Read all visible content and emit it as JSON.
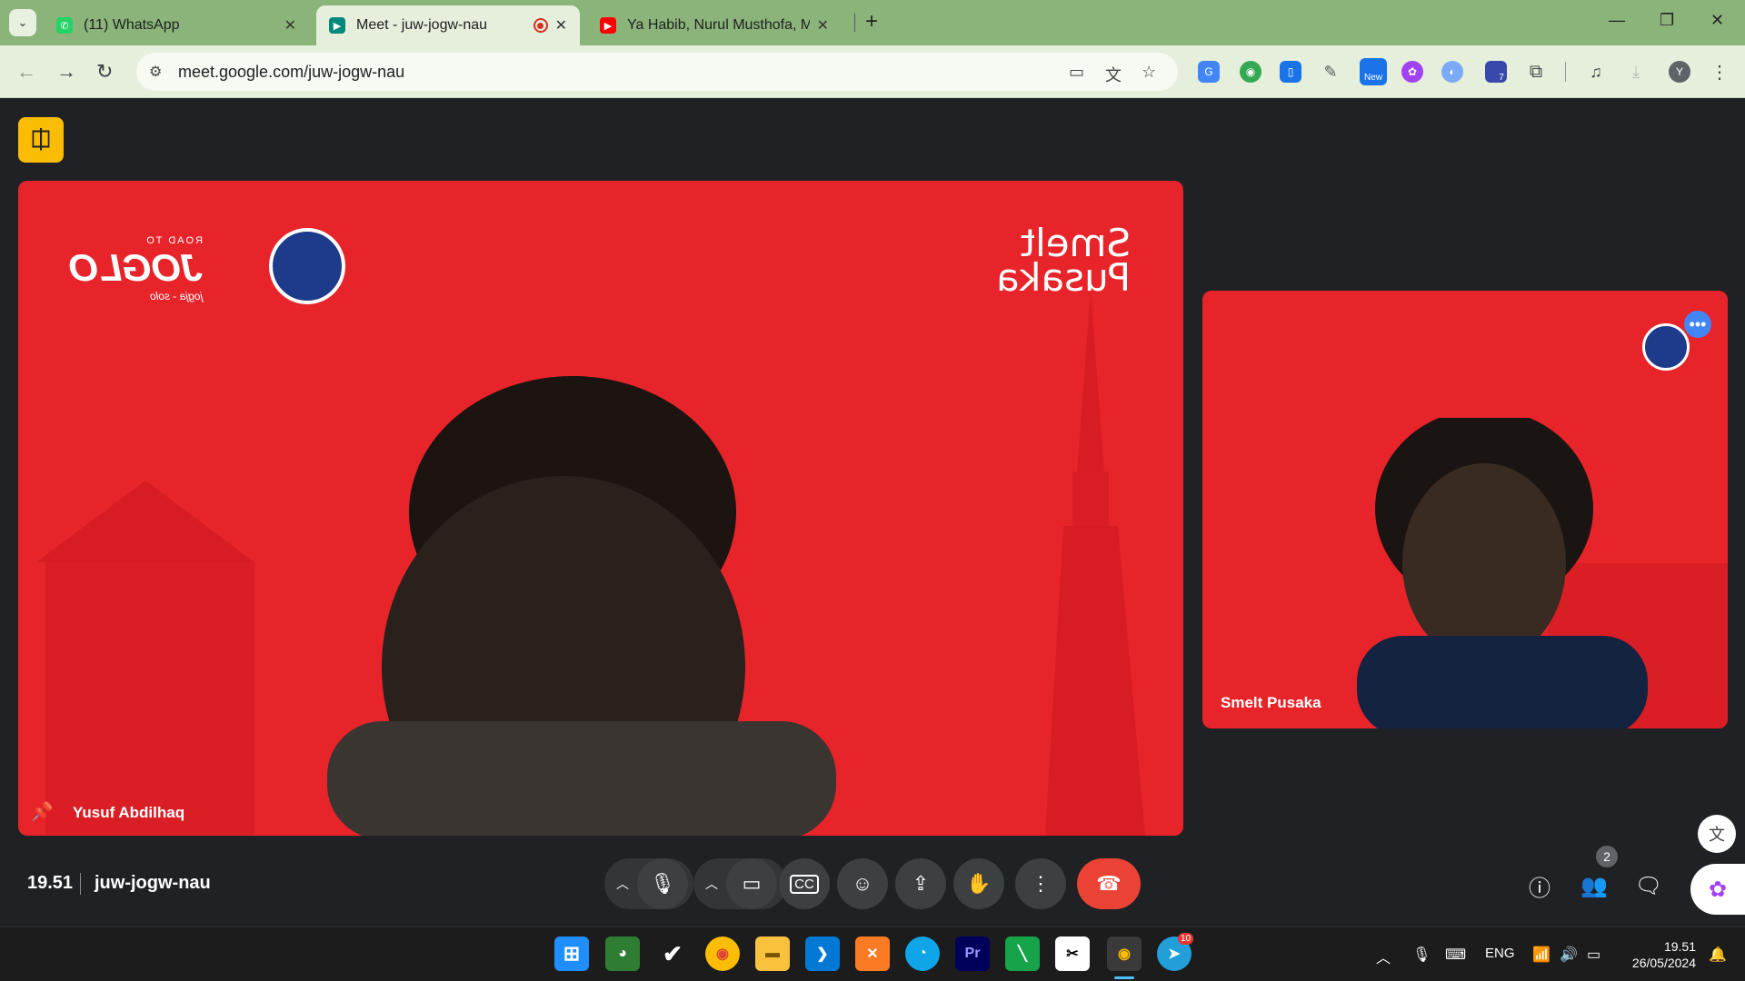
{
  "browser": {
    "tabs": [
      {
        "title": "(11) WhatsApp",
        "icon": "whatsapp-icon",
        "color": "#25d366"
      },
      {
        "title": "Meet - juw-jogw-nau",
        "icon": "google-meet-icon",
        "color": "#00897b"
      },
      {
        "title": "Ya Habib, Nurul Musthofa, Mau",
        "icon": "youtube-icon",
        "color": "#ff0000"
      }
    ],
    "url": "meet.google.com/juw-jogw-nau",
    "extension_badges": {
      "new": "New",
      "count": "7"
    },
    "profile_initial": "Y"
  },
  "meet": {
    "main_participant": {
      "name": "Yusuf Abdilhaq"
    },
    "side_participant": {
      "name": "Smelt Pusaka"
    },
    "background_brand": {
      "line1": "Smelt",
      "line2": "Pusaka",
      "logo_text": "JOGLO",
      "logo_sub": "ROAD TO",
      "logo_caption": "jogja - solo"
    },
    "time": "19.51",
    "meeting_code": "juw-jogw-nau",
    "participant_count": "2",
    "accent_color": "#ea4335"
  },
  "taskbar": {
    "language": "ENG",
    "clock_time": "19.51",
    "clock_date": "26/05/2024",
    "telegram_badge": "10"
  }
}
